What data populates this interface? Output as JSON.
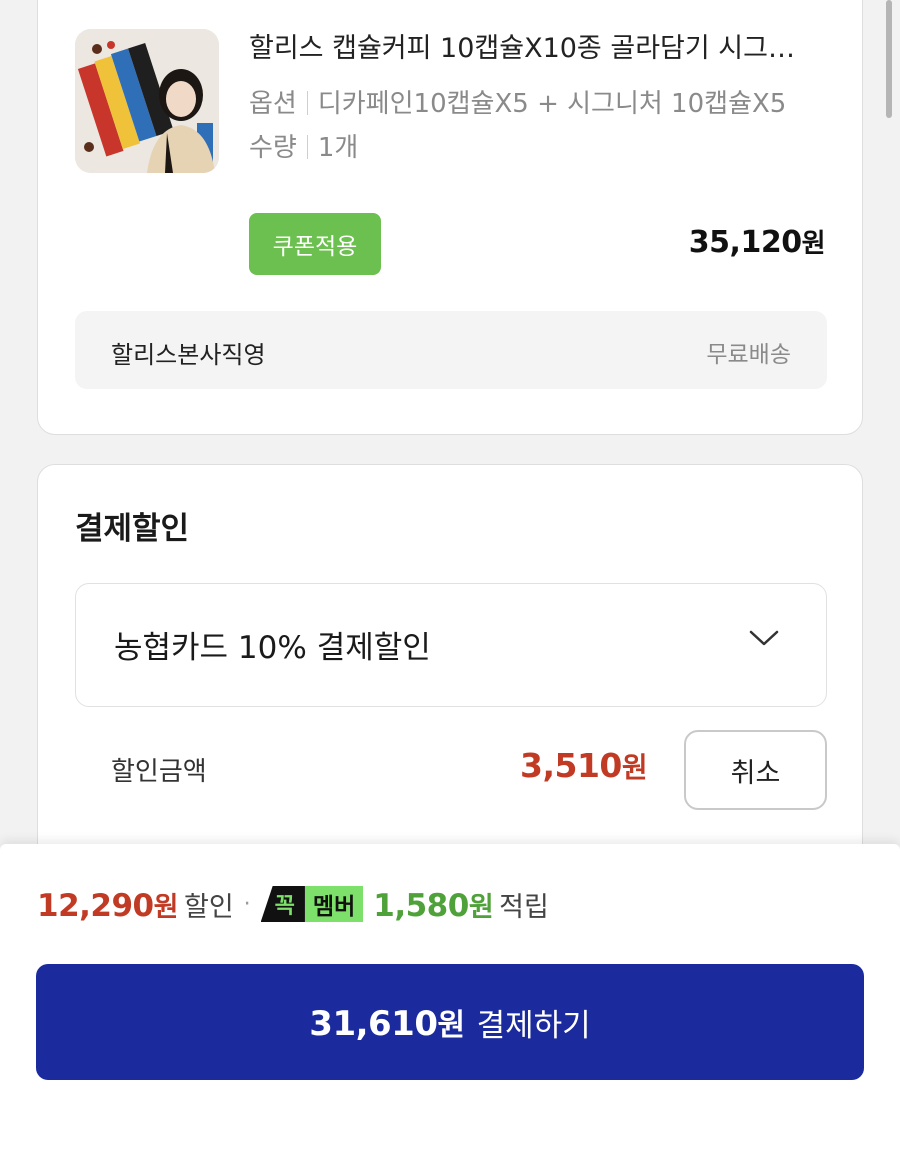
{
  "product": {
    "title": "할리스 캡슐커피 10캡슐X10종 골라담기 시그…",
    "option_label": "옵션",
    "option_value": "디카페인10캡슐X5 + 시그니처 10캡슐X5",
    "qty_label": "수량",
    "qty_value": "1개",
    "coupon_button": "쿠폰적용",
    "price": "35,120",
    "price_unit": "원"
  },
  "seller": {
    "name": "할리스본사직영",
    "shipping": "무료배송"
  },
  "payment_discount": {
    "section_title": "결제할인",
    "selected_option": "농협카드 10% 결제할인",
    "amount_label": "할인금액",
    "amount": "3,510",
    "amount_unit": "원",
    "cancel_button": "취소"
  },
  "summary": {
    "discount_total": "12,290",
    "discount_unit": "원",
    "discount_word": "할인",
    "separator": "·",
    "badge_black": "꼭",
    "badge_green": "멤버",
    "points": "1,580",
    "points_unit": "원",
    "points_word": "적립"
  },
  "pay_button": {
    "amount": "31,610",
    "unit": "원",
    "label": "결제하기"
  },
  "colors": {
    "coupon_green": "#6cc04f",
    "discount_red": "#c13a24",
    "points_green": "#4fa13a",
    "pay_blue": "#1b2b9e"
  }
}
